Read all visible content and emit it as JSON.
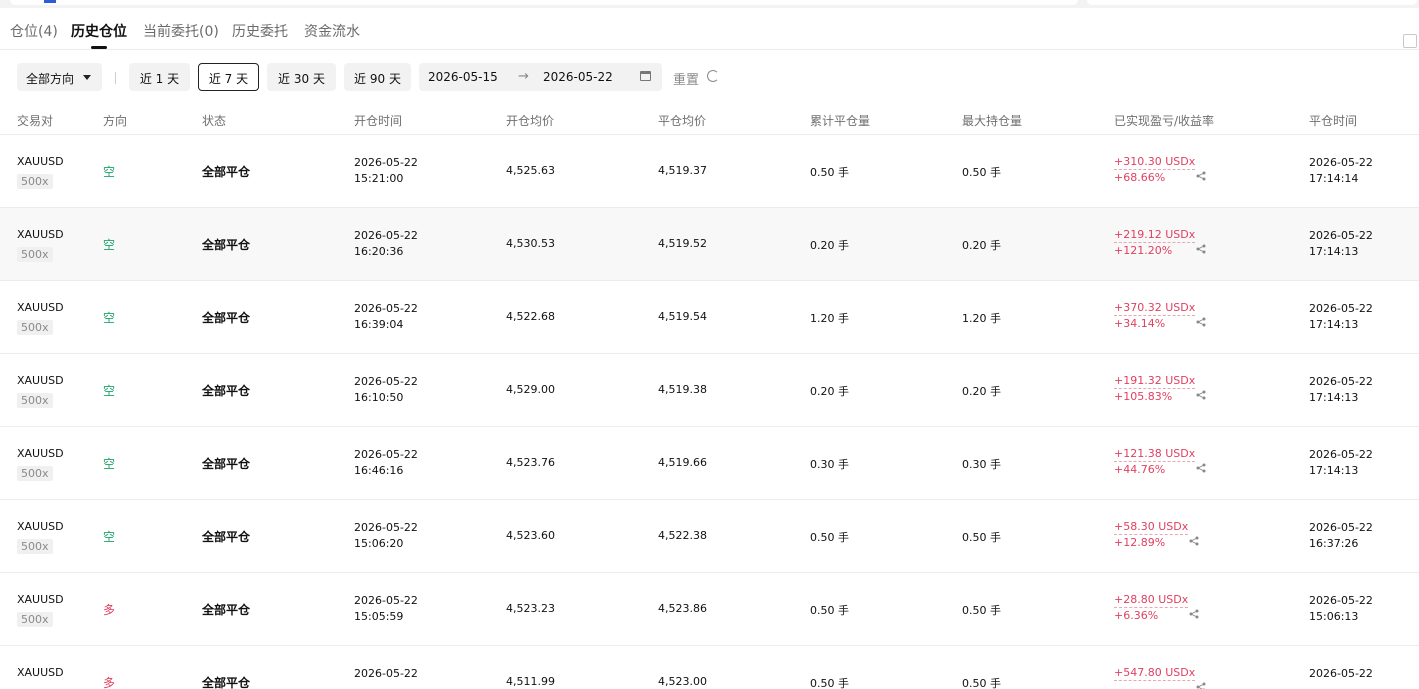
{
  "tabs": [
    {
      "label": "仓位(4)"
    },
    {
      "label": "历史仓位"
    },
    {
      "label": "当前委托(0)"
    },
    {
      "label": "历史委托"
    },
    {
      "label": "资金流水"
    }
  ],
  "filters": {
    "direction": "全部方向",
    "periods": [
      "近 1 天",
      "近 7 天",
      "近 30 天",
      "近 90 天"
    ],
    "active_period": "近 7 天",
    "date_from": "2026-05-15",
    "date_to": "2026-05-22",
    "reset_label": "重置"
  },
  "columns": [
    "交易对",
    "方向",
    "状态",
    "开仓时间",
    "开仓均价",
    "平仓均价",
    "累计平仓量",
    "最大持仓量",
    "已实现盈亏/收益率",
    "平仓时间"
  ],
  "rows": [
    {
      "pair": "XAUUSD",
      "leverage": "500x",
      "direction": "空",
      "status": "全部平仓",
      "open_date": "2026-05-22",
      "open_time": "15:21:00",
      "open_avg": "4,525.63",
      "close_avg": "4,519.37",
      "cum_volume": "0.50 手",
      "max_volume": "0.50 手",
      "pnl": "+310.30 USDx",
      "rate": "+68.66%",
      "close_date": "2026-05-22",
      "close_time": "17:14:14"
    },
    {
      "pair": "XAUUSD",
      "leverage": "500x",
      "direction": "空",
      "status": "全部平仓",
      "open_date": "2026-05-22",
      "open_time": "16:20:36",
      "open_avg": "4,530.53",
      "close_avg": "4,519.52",
      "cum_volume": "0.20 手",
      "max_volume": "0.20 手",
      "pnl": "+219.12 USDx",
      "rate": "+121.20%",
      "close_date": "2026-05-22",
      "close_time": "17:14:13"
    },
    {
      "pair": "XAUUSD",
      "leverage": "500x",
      "direction": "空",
      "status": "全部平仓",
      "open_date": "2026-05-22",
      "open_time": "16:39:04",
      "open_avg": "4,522.68",
      "close_avg": "4,519.54",
      "cum_volume": "1.20 手",
      "max_volume": "1.20 手",
      "pnl": "+370.32 USDx",
      "rate": "+34.14%",
      "close_date": "2026-05-22",
      "close_time": "17:14:13"
    },
    {
      "pair": "XAUUSD",
      "leverage": "500x",
      "direction": "空",
      "status": "全部平仓",
      "open_date": "2026-05-22",
      "open_time": "16:10:50",
      "open_avg": "4,529.00",
      "close_avg": "4,519.38",
      "cum_volume": "0.20 手",
      "max_volume": "0.20 手",
      "pnl": "+191.32 USDx",
      "rate": "+105.83%",
      "close_date": "2026-05-22",
      "close_time": "17:14:13"
    },
    {
      "pair": "XAUUSD",
      "leverage": "500x",
      "direction": "空",
      "status": "全部平仓",
      "open_date": "2026-05-22",
      "open_time": "16:46:16",
      "open_avg": "4,523.76",
      "close_avg": "4,519.66",
      "cum_volume": "0.30 手",
      "max_volume": "0.30 手",
      "pnl": "+121.38 USDx",
      "rate": "+44.76%",
      "close_date": "2026-05-22",
      "close_time": "17:14:13"
    },
    {
      "pair": "XAUUSD",
      "leverage": "500x",
      "direction": "空",
      "status": "全部平仓",
      "open_date": "2026-05-22",
      "open_time": "15:06:20",
      "open_avg": "4,523.60",
      "close_avg": "4,522.38",
      "cum_volume": "0.50 手",
      "max_volume": "0.50 手",
      "pnl": "+58.30 USDx",
      "rate": "+12.89%",
      "close_date": "2026-05-22",
      "close_time": "16:37:26"
    },
    {
      "pair": "XAUUSD",
      "leverage": "500x",
      "direction": "多",
      "status": "全部平仓",
      "open_date": "2026-05-22",
      "open_time": "15:05:59",
      "open_avg": "4,523.23",
      "close_avg": "4,523.86",
      "cum_volume": "0.50 手",
      "max_volume": "0.50 手",
      "pnl": "+28.80 USDx",
      "rate": "+6.36%",
      "close_date": "2026-05-22",
      "close_time": "15:06:13"
    },
    {
      "pair": "XAUUSD",
      "leverage": "",
      "direction": "多",
      "status": "全部平仓",
      "open_date": "2026-05-22",
      "open_time": "",
      "open_avg": "4,511.99",
      "close_avg": "4,523.00",
      "cum_volume": "0.50 手",
      "max_volume": "0.50 手",
      "pnl": "+547.80 USDx",
      "rate": "",
      "close_date": "2026-05-22",
      "close_time": ""
    }
  ],
  "colors": {
    "short": "#1ea36a",
    "long": "#e04060",
    "profit": "#e04060"
  }
}
